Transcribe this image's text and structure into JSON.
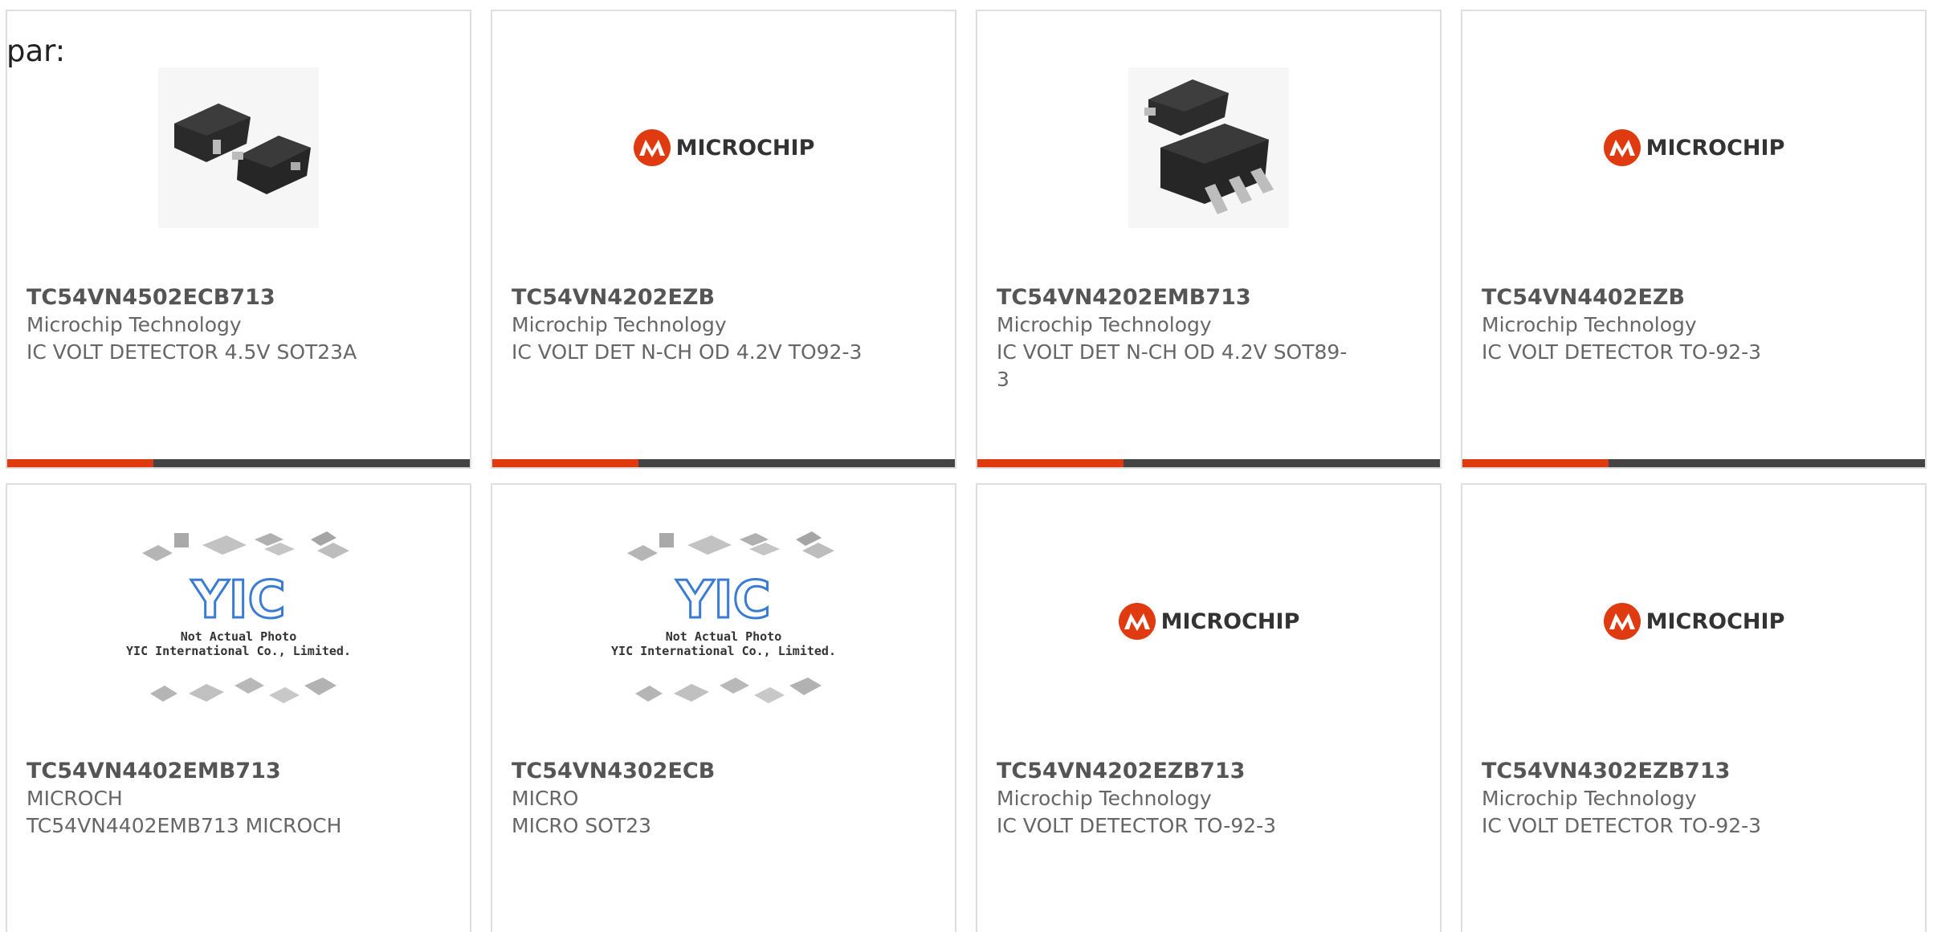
{
  "header": {
    "label": "par:"
  },
  "colors": {
    "accent": "#e03a10",
    "bar": "#444444",
    "border": "#dedede",
    "text": "#666666",
    "logo_red": "#e03a10"
  },
  "cards": [
    {
      "part": "TC54VN4502ECB713",
      "maker": "Microchip Technology",
      "desc": "IC VOLT DETECTOR 4.5V SOT23A",
      "image": "sot23-photo",
      "has_bar": true
    },
    {
      "part": "TC54VN4202EZB",
      "maker": "Microchip Technology",
      "desc": "IC VOLT DET N-CH OD 4.2V TO92-3",
      "image": "microchip-logo",
      "has_bar": true
    },
    {
      "part": "TC54VN4202EMB713",
      "maker": "Microchip Technology",
      "desc": "IC VOLT DET N-CH OD 4.2V SOT89-3",
      "image": "sot89-photo",
      "has_bar": true
    },
    {
      "part": "TC54VN4402EZB",
      "maker": "Microchip Technology",
      "desc": "IC VOLT DETECTOR TO-92-3",
      "image": "microchip-logo",
      "has_bar": true
    },
    {
      "part": "TC54VN4402EMB713",
      "maker": "MICROCH",
      "desc": "TC54VN4402EMB713 MICROCH",
      "image": "yic-placeholder",
      "has_bar": false
    },
    {
      "part": "TC54VN4302ECB",
      "maker": "MICRO",
      "desc": "MICRO SOT23",
      "image": "yic-placeholder",
      "has_bar": false
    },
    {
      "part": "TC54VN4202EZB713",
      "maker": "Microchip Technology",
      "desc": "IC VOLT DETECTOR TO-92-3",
      "image": "microchip-logo",
      "has_bar": false
    },
    {
      "part": "TC54VN4302EZB713",
      "maker": "Microchip Technology",
      "desc": "IC VOLT DETECTOR TO-92-3",
      "image": "microchip-logo",
      "has_bar": false
    }
  ],
  "logo": {
    "text": "MICROCHIP"
  },
  "placeholder": {
    "line1": "Not Actual Photo",
    "line2": "YIC International Co., Limited.",
    "brand": "YIC"
  }
}
